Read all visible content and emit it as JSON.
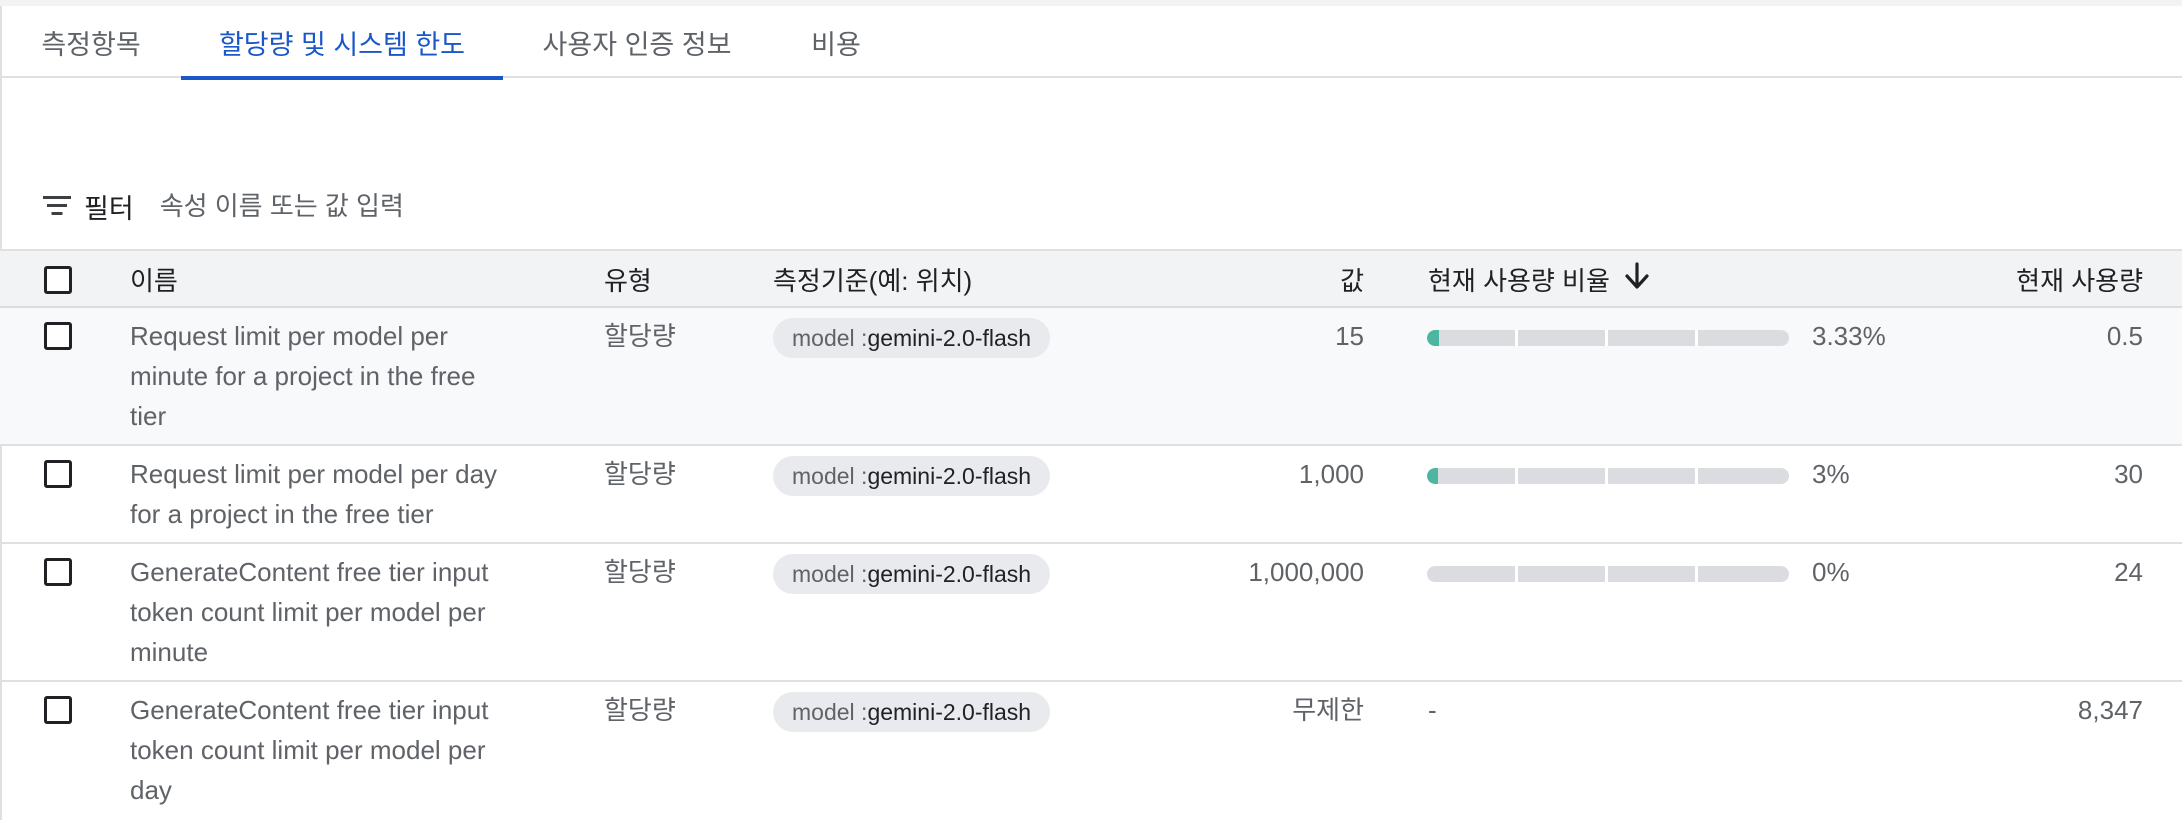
{
  "tabs": [
    {
      "label": "측정항목",
      "active": false
    },
    {
      "label": "할당량 및 시스템 한도",
      "active": true
    },
    {
      "label": "사용자 인증 정보",
      "active": false
    },
    {
      "label": "비용",
      "active": false
    }
  ],
  "filter": {
    "label": "필터",
    "placeholder": "속성 이름 또는 값 입력",
    "icon": "filter-list-icon"
  },
  "table": {
    "headers": {
      "name": "이름",
      "type": "유형",
      "dimensions": "측정기준(예: 위치)",
      "value": "값",
      "usage_pct": "현재 사용량 비율",
      "usage": "현재 사용량"
    },
    "sort": {
      "column": "usage_pct",
      "direction": "descending",
      "icon": "arrow-down-icon"
    },
    "rows": [
      {
        "name": [
          "Request limit per model per",
          "minute for a project in the free",
          "tier"
        ],
        "type": "할당량",
        "dim_key": "model : ",
        "dim_value": "gemini-2.0-flash",
        "value": "15",
        "usage_pct": "3.33%",
        "usage_fraction": 0.0333,
        "usage": "0.5"
      },
      {
        "name": [
          "Request limit per model per day",
          "for a project in the free tier"
        ],
        "type": "할당량",
        "dim_key": "model : ",
        "dim_value": "gemini-2.0-flash",
        "value": "1,000",
        "usage_pct": "3%",
        "usage_fraction": 0.03,
        "usage": "30"
      },
      {
        "name": [
          "GenerateContent free tier input",
          "token count limit per model per",
          "minute"
        ],
        "type": "할당량",
        "dim_key": "model : ",
        "dim_value": "gemini-2.0-flash",
        "value": "1,000,000",
        "usage_pct": "0%",
        "usage_fraction": 0,
        "usage": "24"
      },
      {
        "name": [
          "GenerateContent free tier input",
          "token count limit per model per",
          "day"
        ],
        "type": "할당량",
        "dim_key": "model : ",
        "dim_value": "gemini-2.0-flash",
        "value": "무제한",
        "usage_pct": "-",
        "usage_fraction": null,
        "usage": "8,347"
      }
    ]
  },
  "colors": {
    "accent": "#1a57c8",
    "usage_bar": "#4db6a0",
    "bar_track": "#dadce0",
    "header_bg": "#f1f3f4"
  }
}
